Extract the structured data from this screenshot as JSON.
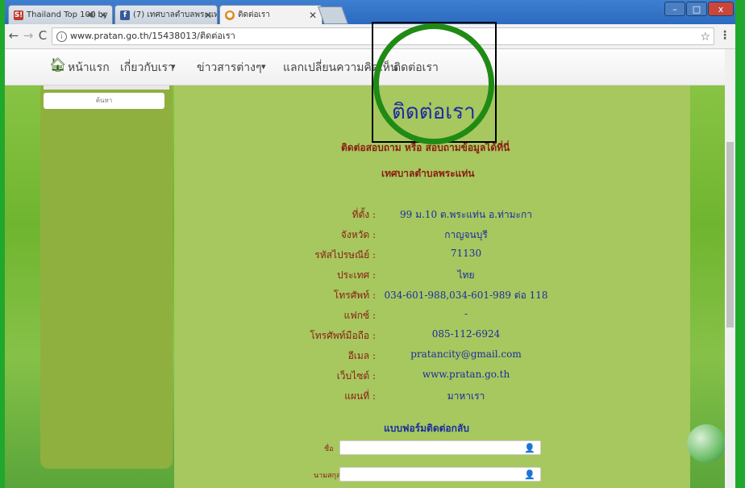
{
  "browser": {
    "tabs": [
      {
        "label": "Thailand Top 100 by",
        "favicon": "S!",
        "favicon_color": "#c0392b",
        "has_audio": true
      },
      {
        "label": "(7) เทศบาลตำบลพระแท่น - ",
        "favicon": "f",
        "favicon_color": "#3b5998"
      },
      {
        "label": "ติดต่อเรา",
        "favicon": "●",
        "favicon_color": "#e08a1e",
        "active": true
      }
    ],
    "close_glyph": "✕",
    "audio_glyph": "◀)",
    "window_buttons": {
      "minimize": "–",
      "maximize": "□",
      "close": "x"
    },
    "url": "www.pratan.go.th/15438013/ติดต่อเรา",
    "info_glyph": "i",
    "star_glyph": "☆",
    "menu_glyph": "⋮"
  },
  "navbar": {
    "home_icon": "home-icon",
    "items": [
      {
        "label": "หน้าแรก",
        "has_dropdown": false
      },
      {
        "label": "เกี่ยวกับเรา",
        "has_dropdown": true
      },
      {
        "label": "ข่าวสารต่างๆ",
        "has_dropdown": true
      },
      {
        "label": "แลกเปลี่ยนความคิดเห็น",
        "has_dropdown": false
      },
      {
        "label": "ติดต่อเรา",
        "has_dropdown": false
      }
    ],
    "dropdown_glyph": "▾"
  },
  "sidebar": {
    "search_label": "ค้นหา"
  },
  "main": {
    "title": "ติดต่อเรา",
    "intro": "ติดต่อสอบถาม หรือ สอบถามข้อมูลได้ที่นี่",
    "org_name": "เทศบาลตำบลพระแท่น",
    "rows": [
      {
        "label": "ที่ตั้ง :",
        "value": "99 ม.10 ต.พระแท่น อ.ท่ามะกา"
      },
      {
        "label": "จังหวัด :",
        "value": "กาญจนบุรี"
      },
      {
        "label": "รหัสไปรษณีย์ :",
        "value": "71130"
      },
      {
        "label": "ประเทศ :",
        "value": "ไทย"
      },
      {
        "label": "โทรศัพท์ :",
        "value": "034-601-988,034-601-989 ต่อ 118"
      },
      {
        "label": "แฟกซ์ :",
        "value": "-"
      },
      {
        "label": "โทรศัพท์มือถือ :",
        "value": "085-112-6924"
      },
      {
        "label": "อีเมล :",
        "value": "pratancity@gmail.com"
      },
      {
        "label": "เว็บไซต์ :",
        "value": "www.pratan.go.th"
      },
      {
        "label": "แผนที่ :",
        "value": "มาหาเรา"
      }
    ]
  },
  "form": {
    "title": "แบบฟอร์มติดต่อกลับ",
    "fields": [
      {
        "label": "ชื่อ",
        "value": "",
        "icon": "user-icon"
      },
      {
        "label": "นามสกุล",
        "value": "",
        "icon": "user-icon"
      }
    ],
    "user_glyph": "👤"
  },
  "colors": {
    "annotation_circle": "#1f8a14",
    "annotation_box": "#000000",
    "label_color": "#8a1c12",
    "value_color": "#1d2c9e",
    "page_green": "#a6c85f"
  }
}
